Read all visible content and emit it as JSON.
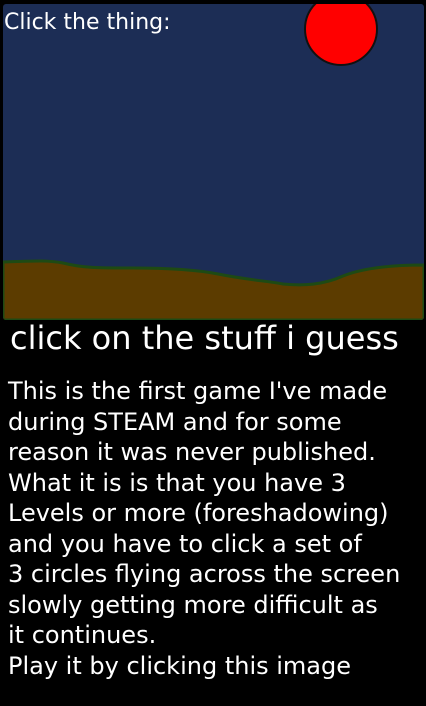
{
  "game": {
    "prompt": "Click the thing:",
    "sky_color": "#1c2d55",
    "ground_color": "#5c3c00",
    "ground_edge_color": "#1e4a14",
    "target_color": "#ff0000",
    "target_outline_color": "#111111"
  },
  "title": "click on the stuff i guess",
  "description": {
    "lines": [
      "This is the first game I've made",
      "during STEAM and for some",
      "reason it was never published.",
      "What it is is that you have 3",
      "Levels or more (foreshadowing)",
      "and you have to click a set of",
      "3 circles flying across the screen",
      "slowly getting more difficult as",
      "it continues.",
      "Play it by clicking this image"
    ]
  }
}
